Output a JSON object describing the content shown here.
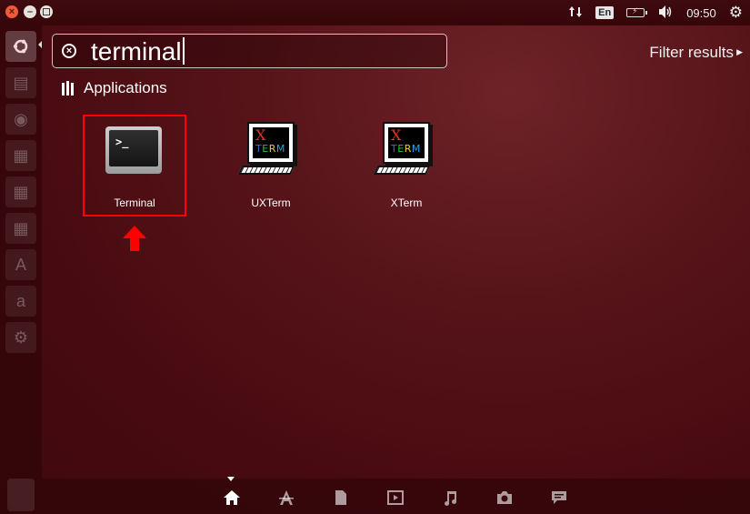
{
  "top_panel": {
    "keyboard_layout": "En",
    "clock": "09:50"
  },
  "search": {
    "query": "terminal"
  },
  "filter": {
    "label": "Filter results"
  },
  "category": {
    "title": "Applications"
  },
  "apps": [
    {
      "name": "Terminal"
    },
    {
      "name": "UXTerm"
    },
    {
      "name": "XTerm"
    }
  ],
  "icons": {
    "close": "close-icon",
    "minimize": "minimize-icon",
    "maximize": "maximize-icon",
    "network": "network-updown-icon",
    "battery": "battery-charging-icon",
    "volume": "volume-icon",
    "session": "gear-icon",
    "search_clear": "clear-search-icon",
    "lenses": [
      "home-icon",
      "applications-icon",
      "files-icon",
      "video-icon",
      "music-icon",
      "photo-icon",
      "social-icon"
    ]
  },
  "colors": {
    "highlight": "#ff0000",
    "background": "#4a0a10",
    "xterm_x": "#e83020"
  }
}
